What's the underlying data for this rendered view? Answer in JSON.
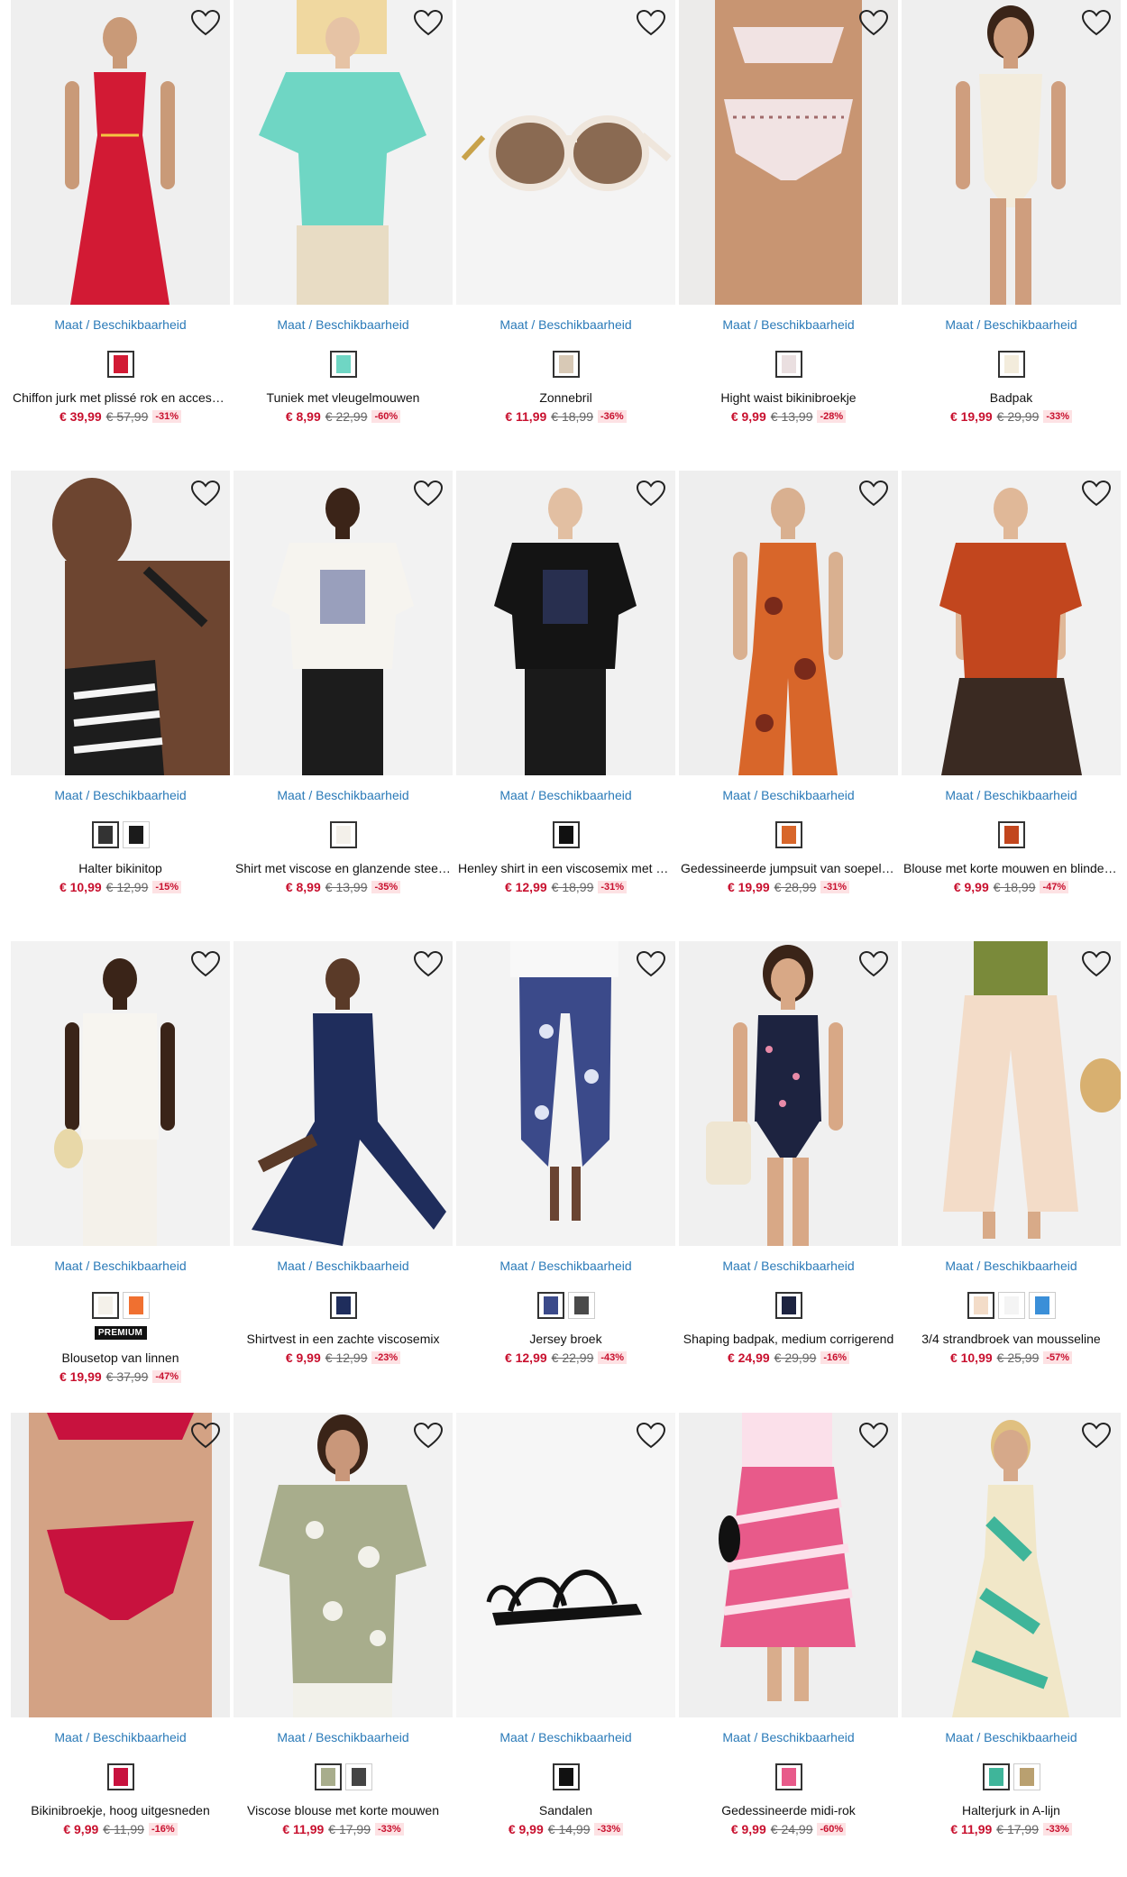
{
  "labels": {
    "size_link": "Maat / Beschikbaarheid"
  },
  "colors": {
    "price_red": "#c8102e",
    "link_blue": "#2a7ab8",
    "discount_bg": "#fde2e4"
  },
  "products": [
    {
      "name": "Chiffon jurk met plissé rok en accessoire",
      "price": "€ 39,99",
      "old_price": "€ 57,99",
      "discount": "-31%",
      "swatches": [
        "#d21a34"
      ],
      "badge": "",
      "image": {
        "bg": "#efefef",
        "figure": "dress-red",
        "main": "#d21a34",
        "alt": "#d21a34",
        "skin": "#c99a78"
      }
    },
    {
      "name": "Tuniek met vleugelmouwen",
      "price": "€ 8,99",
      "old_price": "€ 22,99",
      "discount": "-60%",
      "swatches": [
        "#6fd6c4"
      ],
      "badge": "",
      "image": {
        "bg": "#f2f2f2",
        "figure": "top",
        "main": "#6fd6c4",
        "alt": "#e8dcc4",
        "skin": "#e6c3a5"
      }
    },
    {
      "name": "Zonnebril",
      "price": "€ 11,99",
      "old_price": "€ 18,99",
      "discount": "-36%",
      "swatches": [
        "#d8c9b6"
      ],
      "badge": "",
      "image": {
        "bg": "#f4f4f4",
        "figure": "sunglasses",
        "main": "#efe6dc",
        "alt": "#8a6a52",
        "skin": "#c8a24a"
      }
    },
    {
      "name": "Hight waist bikinibroekje",
      "price": "€ 9,99",
      "old_price": "€ 13,99",
      "discount": "-28%",
      "swatches": [
        "#eadfe0"
      ],
      "badge": "",
      "image": {
        "bg": "#ecebea",
        "figure": "bikini-bottom",
        "main": "#f1e3e3",
        "alt": "#a06a6a",
        "skin": "#c89572"
      }
    },
    {
      "name": "Badpak",
      "price": "€ 19,99",
      "old_price": "€ 29,99",
      "discount": "-33%",
      "swatches": [
        "#f3ecdc"
      ],
      "badge": "",
      "image": {
        "bg": "#efefef",
        "figure": "swimsuit",
        "main": "#f3ecdc",
        "alt": "#f3ecdc",
        "skin": "#cf9e7e"
      }
    },
    {
      "name": "Halter bikinitop",
      "price": "€ 10,99",
      "old_price": "€ 12,99",
      "discount": "-15%",
      "swatches": [
        "#333333",
        "#1b1b1b"
      ],
      "badge": "",
      "image": {
        "bg": "#f0f0f0",
        "figure": "halter",
        "main": "#1d1d1d",
        "alt": "#f5f5f5",
        "skin": "#6d4530"
      }
    },
    {
      "name": "Shirt met viscose en glanzende steentjes",
      "price": "€ 8,99",
      "old_price": "€ 13,99",
      "discount": "-35%",
      "swatches": [
        "#f3f0ea"
      ],
      "badge": "",
      "image": {
        "bg": "#f2f2f2",
        "figure": "tee",
        "main": "#f6f4ef",
        "alt": "#1c1c1c",
        "skin": "#3b2418"
      }
    },
    {
      "name": "Henley shirt in een viscosemix met stippen",
      "price": "€ 12,99",
      "old_price": "€ 18,99",
      "discount": "-31%",
      "swatches": [
        "#111111"
      ],
      "badge": "",
      "image": {
        "bg": "#f1f1f1",
        "figure": "tee",
        "main": "#141414",
        "alt": "#1a1a1a",
        "skin": "#e2bfa2"
      }
    },
    {
      "name": "Gedessineerde jumpsuit van soepele viscose",
      "price": "€ 19,99",
      "old_price": "€ 28,99",
      "discount": "-31%",
      "swatches": [
        "#d8662a"
      ],
      "badge": "",
      "image": {
        "bg": "#eeeeee",
        "figure": "jumpsuit",
        "main": "#d8662a",
        "alt": "#7a2a1a",
        "skin": "#d9b090"
      }
    },
    {
      "name": "Blouse met korte mouwen en blinde knoopsluiting",
      "price": "€ 9,99",
      "old_price": "€ 18,99",
      "discount": "-47%",
      "swatches": [
        "#c2461e"
      ],
      "badge": "",
      "image": {
        "bg": "#f1f1f1",
        "figure": "blouse",
        "main": "#c2461e",
        "alt": "#3a2a22",
        "skin": "#e0b898"
      }
    },
    {
      "name": "Blousetop van linnen",
      "price": "€ 19,99",
      "old_price": "€ 37,99",
      "discount": "-47%",
      "swatches": [
        "#f4f1ea",
        "#f07030"
      ],
      "badge": "PREMIUM",
      "image": {
        "bg": "#f2f2f2",
        "figure": "vest",
        "main": "#f7f5f0",
        "alt": "#f4f1ea",
        "skin": "#3a2418"
      }
    },
    {
      "name": "Shirtvest in een zachte viscosemix",
      "price": "€ 9,99",
      "old_price": "€ 12,99",
      "discount": "-23%",
      "swatches": [
        "#1f2d5c"
      ],
      "badge": "",
      "image": {
        "bg": "#f3f3f3",
        "figure": "cardigan",
        "main": "#1f2d5c",
        "alt": "#26356c",
        "skin": "#5a3a28"
      }
    },
    {
      "name": "Jersey broek",
      "price": "€ 12,99",
      "old_price": "€ 22,99",
      "discount": "-43%",
      "swatches": [
        "#3b4a8a",
        "#4a4a4a"
      ],
      "badge": "",
      "image": {
        "bg": "#f3f3f3",
        "figure": "trousers",
        "main": "#3b4a8a",
        "alt": "#dfe4f4",
        "skin": "#6a4432"
      }
    },
    {
      "name": "Shaping badpak, medium corrigerend",
      "price": "€ 24,99",
      "old_price": "€ 29,99",
      "discount": "-16%",
      "swatches": [
        "#1d2340"
      ],
      "badge": "",
      "image": {
        "bg": "#f0f0f0",
        "figure": "tankini",
        "main": "#1d2340",
        "alt": "#e88aa8",
        "skin": "#d8a886"
      }
    },
    {
      "name": "3/4 strandbroek van mousseline",
      "price": "€ 10,99",
      "old_price": "€ 25,99",
      "discount": "-57%",
      "swatches": [
        "#f3dcc8",
        "#f4f4f4",
        "#3b8fd8"
      ],
      "badge": "",
      "image": {
        "bg": "#f1f1f1",
        "figure": "wide-pants",
        "main": "#f3dcc8",
        "alt": "#7a8a3a",
        "skin": "#d8aa88"
      }
    },
    {
      "name": "Bikinibroekje, hoog uitgesneden",
      "price": "€ 9,99",
      "old_price": "€ 11,99",
      "discount": "-16%",
      "swatches": [
        "#c8123e"
      ],
      "badge": "",
      "image": {
        "bg": "#eeeeee",
        "figure": "bikini-red",
        "main": "#c8123e",
        "alt": "#c8123e",
        "skin": "#d3a284"
      }
    },
    {
      "name": "Viscose blouse met korte mouwen",
      "price": "€ 11,99",
      "old_price": "€ 17,99",
      "discount": "-33%",
      "swatches": [
        "#a8ad8c",
        "#444444"
      ],
      "badge": "",
      "image": {
        "bg": "#f2f2f2",
        "figure": "shirt-print",
        "main": "#a8ad8c",
        "alt": "#f2f1ea",
        "skin": "#c9977a"
      }
    },
    {
      "name": "Sandalen",
      "price": "€ 9,99",
      "old_price": "€ 14,99",
      "discount": "-33%",
      "swatches": [
        "#111111"
      ],
      "badge": "",
      "image": {
        "bg": "#f6f6f6",
        "figure": "sandal",
        "main": "#111111",
        "alt": "#222222",
        "skin": "#111111"
      }
    },
    {
      "name": "Gedessineerde midi-rok",
      "price": "€ 9,99",
      "old_price": "€ 24,99",
      "discount": "-60%",
      "swatches": [
        "#e85a8a"
      ],
      "badge": "",
      "image": {
        "bg": "#efefef",
        "figure": "skirt",
        "main": "#e85a8a",
        "alt": "#fbe0ea",
        "skin": "#d9ad8c"
      }
    },
    {
      "name": "Halterjurk in A-lijn",
      "price": "€ 11,99",
      "old_price": "€ 17,99",
      "discount": "-33%",
      "swatches": [
        "#3fb59a",
        "#b9a070"
      ],
      "badge": "",
      "image": {
        "bg": "#f1f1f1",
        "figure": "maxi-print",
        "main": "#3fb59a",
        "alt": "#f1e7c8",
        "skin": "#d6a98a"
      }
    }
  ]
}
